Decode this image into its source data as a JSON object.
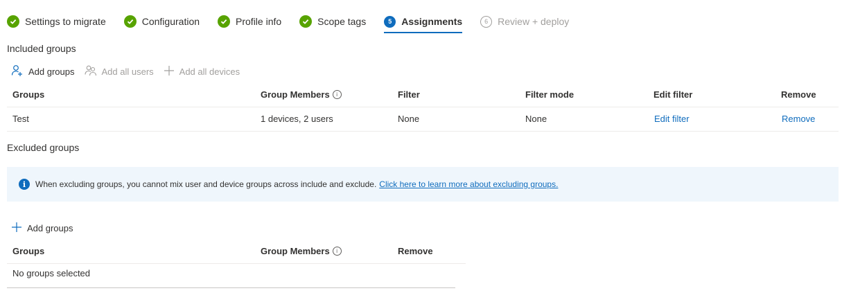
{
  "wizard": {
    "steps": [
      {
        "label": "Settings to migrate",
        "state": "done"
      },
      {
        "label": "Configuration",
        "state": "done"
      },
      {
        "label": "Profile info",
        "state": "done"
      },
      {
        "label": "Scope tags",
        "state": "done"
      },
      {
        "label": "Assignments",
        "state": "current",
        "number": "5"
      },
      {
        "label": "Review + deploy",
        "state": "future",
        "number": "6"
      }
    ]
  },
  "included": {
    "title": "Included groups",
    "toolbar": {
      "add_groups": "Add groups",
      "add_all_users": "Add all users",
      "add_all_devices": "Add all devices"
    },
    "columns": {
      "groups": "Groups",
      "group_members": "Group Members",
      "filter": "Filter",
      "filter_mode": "Filter mode",
      "edit_filter": "Edit filter",
      "remove": "Remove"
    },
    "rows": [
      {
        "group": "Test",
        "members": "1 devices, 2 users",
        "filter": "None",
        "filter_mode": "None",
        "edit_filter": "Edit filter",
        "remove": "Remove"
      }
    ]
  },
  "excluded": {
    "title": "Excluded groups",
    "banner": {
      "icon_text": "i",
      "text": "When excluding groups, you cannot mix user and device groups across include and exclude.",
      "link": "Click here to learn more about excluding groups."
    },
    "toolbar": {
      "add_groups": "Add groups"
    },
    "columns": {
      "groups": "Groups",
      "group_members": "Group Members",
      "remove": "Remove"
    },
    "empty_text": "No groups selected"
  },
  "info_glyph": "i",
  "colors": {
    "accent": "#0f6cbd",
    "success": "#57a300",
    "banner_bg": "#eff6fc",
    "disabled_text": "#a19f9d"
  }
}
